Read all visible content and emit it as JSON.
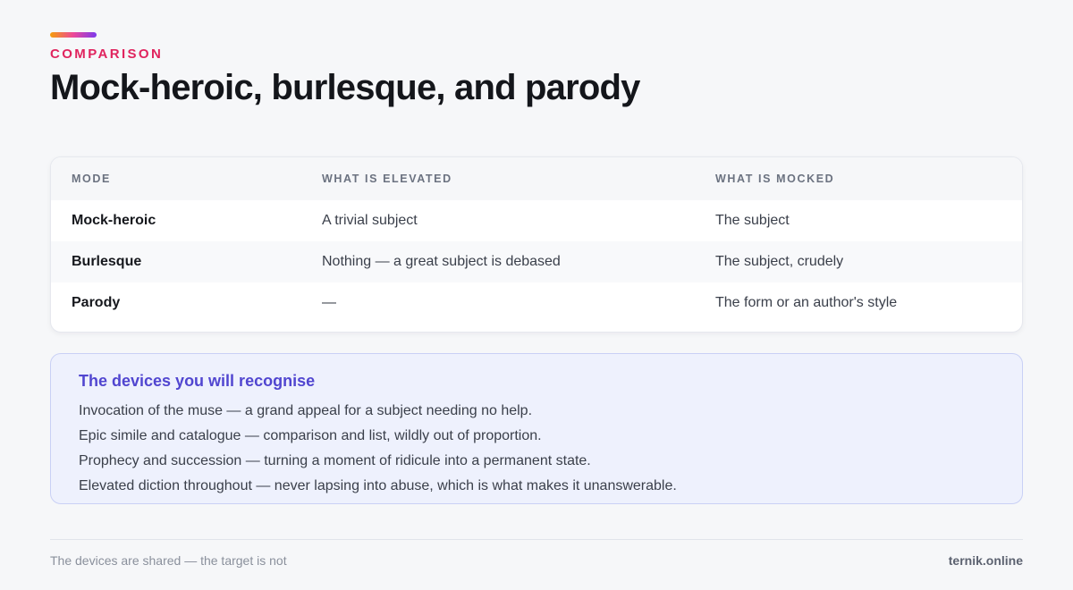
{
  "header": {
    "eyebrow": "COMPARISON",
    "title": "Mock-heroic, burlesque, and parody"
  },
  "table": {
    "columns": [
      "MODE",
      "WHAT IS ELEVATED",
      "WHAT IS MOCKED"
    ],
    "rows": [
      [
        "Mock-heroic",
        "A trivial subject",
        "The subject"
      ],
      [
        "Burlesque",
        "Nothing — a great subject is debased",
        "The subject, crudely"
      ],
      [
        "Parody",
        "—",
        "The form or an author's style"
      ]
    ]
  },
  "callout": {
    "title": "The devices you will recognise",
    "lines": [
      "Invocation of the muse — a grand appeal for a subject needing no help.",
      "Epic simile and catalogue — comparison and list, wildly out of proportion.",
      "Prophecy and succession — turning a moment of ridicule into a permanent state.",
      "Elevated diction throughout — never lapsing into abuse, which is what makes it unanswerable."
    ]
  },
  "footer": {
    "caption": "The devices are shared — the target is not",
    "brand": "ternik.online"
  },
  "colors": {
    "eyebrow": "#e0245e",
    "callout_title": "#5146d0",
    "callout_bg": "#eef1fd"
  }
}
